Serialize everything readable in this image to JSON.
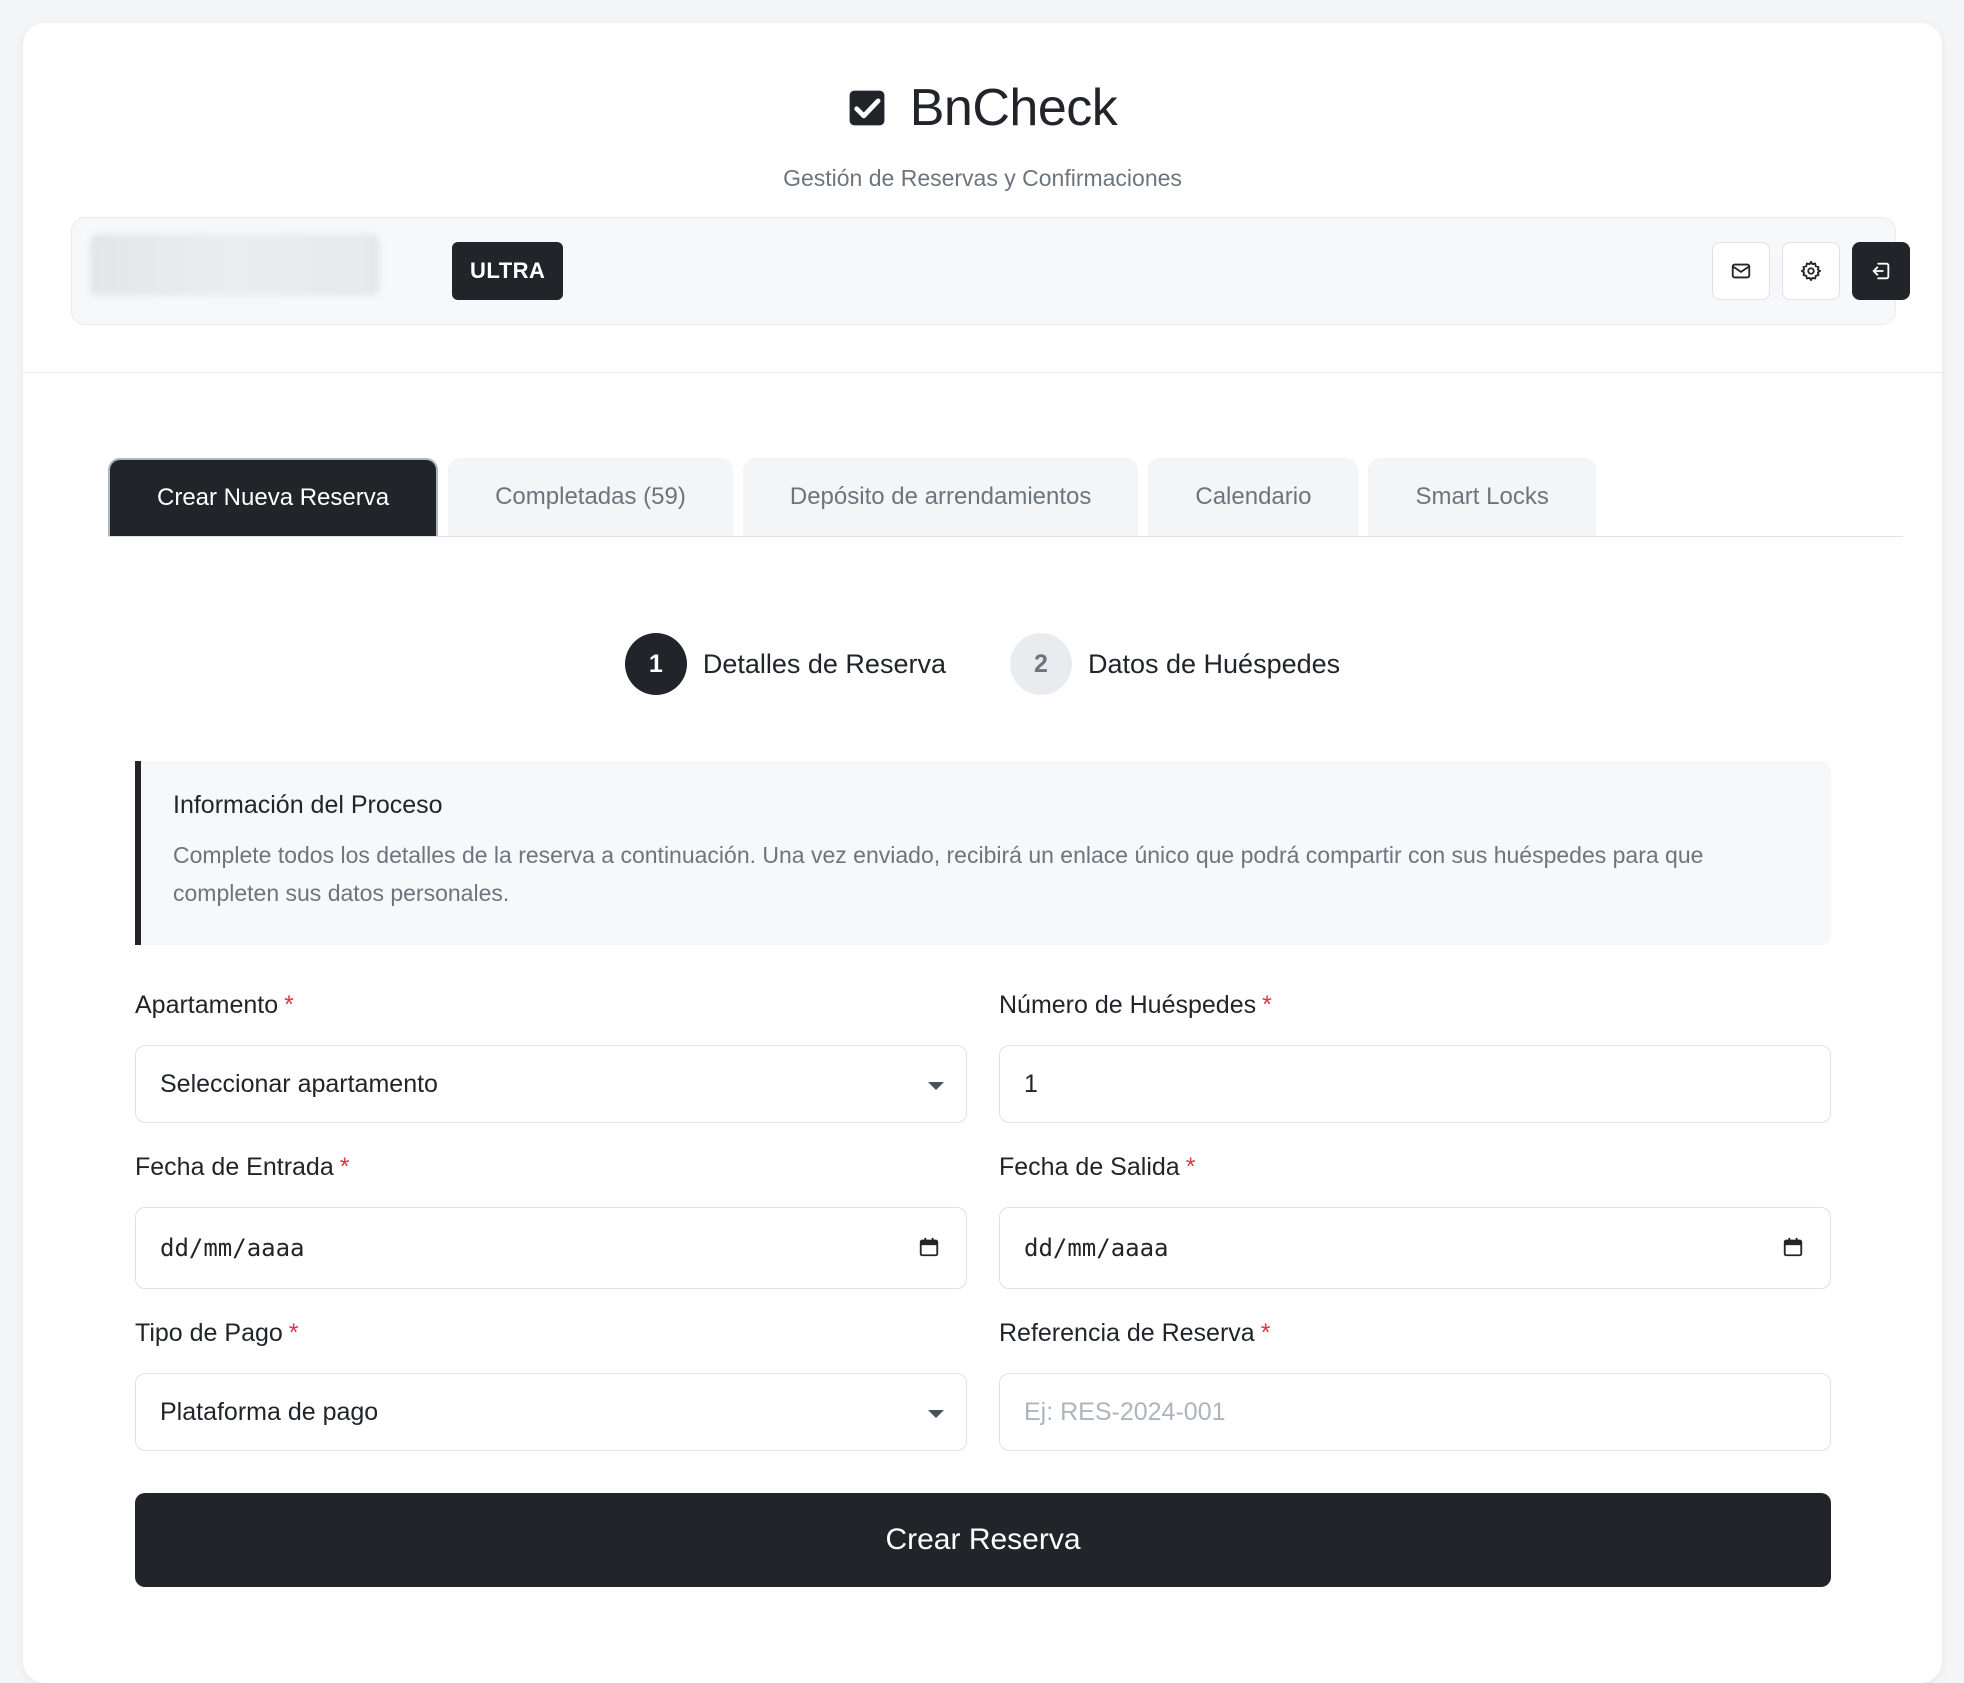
{
  "header": {
    "app_title": "BnCheck",
    "subtitle": "Gestión de Reservas y Confirmaciones",
    "logo_icon": "checkbox-checked-icon"
  },
  "userbar": {
    "plan_badge": "ULTRA",
    "actions": [
      {
        "icon": "mail-icon"
      },
      {
        "icon": "gear-icon"
      },
      {
        "icon": "logout-icon"
      }
    ]
  },
  "tabs": [
    {
      "label": "Crear Nueva Reserva",
      "active": true
    },
    {
      "label": "Completadas (59)",
      "active": false
    },
    {
      "label": "Depósito de arrendamientos",
      "active": false
    },
    {
      "label": "Calendario",
      "active": false
    },
    {
      "label": "Smart Locks",
      "active": false
    }
  ],
  "stepper": [
    {
      "number": "1",
      "label": "Detalles de Reserva",
      "active": true
    },
    {
      "number": "2",
      "label": "Datos de Huéspedes",
      "active": false
    }
  ],
  "info": {
    "title": "Información del Proceso",
    "text": "Complete todos los detalles de la reserva a continuación. Una vez enviado, recibirá un enlace único que podrá compartir con sus huéspedes para que completen sus datos personales."
  },
  "form": {
    "required_marker": "*",
    "apartamento": {
      "label": "Apartamento",
      "value": "Seleccionar apartamento"
    },
    "huespedes": {
      "label": "Número de Huéspedes",
      "value": "1"
    },
    "entrada": {
      "label": "Fecha de Entrada",
      "value": "dd/mm/aaaa"
    },
    "salida": {
      "label": "Fecha de Salida",
      "value": "dd/mm/aaaa"
    },
    "pago": {
      "label": "Tipo de Pago",
      "value": "Plataforma de pago"
    },
    "referencia": {
      "label": "Referencia de Reserva",
      "value": "",
      "placeholder": "Ej: RES-2024-001"
    }
  },
  "submit_label": "Crear Reserva",
  "colors": {
    "primary": "#212529",
    "required": "#dc3545",
    "muted": "#6c757d"
  }
}
